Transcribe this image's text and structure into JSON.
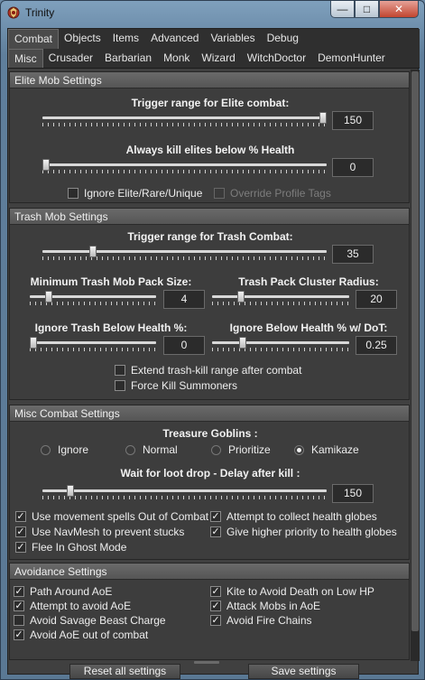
{
  "window": {
    "title": "Trinity",
    "minimize": "—",
    "maximize": "□",
    "close": "✕"
  },
  "tabs_row1": [
    "Combat",
    "Objects",
    "Items",
    "Advanced",
    "Variables",
    "Debug"
  ],
  "tabs_row2": [
    "Misc",
    "Crusader",
    "Barbarian",
    "Monk",
    "Wizard",
    "WitchDoctor",
    "DemonHunter"
  ],
  "elite": {
    "header": "Elite Mob Settings",
    "trigger_label": "Trigger range for Elite combat:",
    "trigger_value": "150",
    "kill_label": "Always kill elites below % Health",
    "kill_value": "0",
    "ignore_label": "Ignore Elite/Rare/Unique",
    "override_label": "Override Profile Tags"
  },
  "trash": {
    "header": "Trash Mob Settings",
    "trigger_label": "Trigger range for Trash Combat:",
    "trigger_value": "35",
    "min_pack_label": "Minimum Trash Mob Pack Size:",
    "min_pack_value": "4",
    "cluster_label": "Trash Pack Cluster Radius:",
    "cluster_value": "20",
    "ignore_health_label": "Ignore Trash Below Health %:",
    "ignore_health_value": "0",
    "ignore_dot_label": "Ignore Below Health % w/ DoT:",
    "ignore_dot_value": "0.25",
    "extend_label": "Extend trash-kill range after combat",
    "summoners_label": "Force Kill Summoners"
  },
  "misc": {
    "header": "Misc Combat Settings",
    "goblins_label": "Treasure Goblins :",
    "goblin_options": [
      "Ignore",
      "Normal",
      "Prioritize",
      "Kamikaze"
    ],
    "goblin_selected": "Kamikaze",
    "loot_label": "Wait for loot drop - Delay after kill :",
    "loot_value": "150",
    "movement_spells": "Use movement spells Out of Combat",
    "health_globes": "Attempt to collect health globes",
    "navmesh": "Use NavMesh to prevent stucks",
    "priority_globes": "Give higher priority to health globes",
    "ghost_mode": "Flee In Ghost Mode"
  },
  "avoid": {
    "header": "Avoidance Settings",
    "path_around": "Path Around AoE",
    "kite": "Kite to Avoid Death on Low HP",
    "attempt_avoid": "Attempt to avoid AoE",
    "attack_mobs": "Attack Mobs in AoE",
    "savage_beast": "Avoid Savage Beast Charge",
    "fire_chains": "Avoid Fire Chains",
    "out_of_combat": "Avoid AoE out of combat"
  },
  "footer": {
    "reset": "Reset all settings",
    "save": "Save settings"
  },
  "colors": {
    "panel": "#404040",
    "section": "#3d3d3d",
    "header": "#555555",
    "window": "#6c8aa6"
  }
}
